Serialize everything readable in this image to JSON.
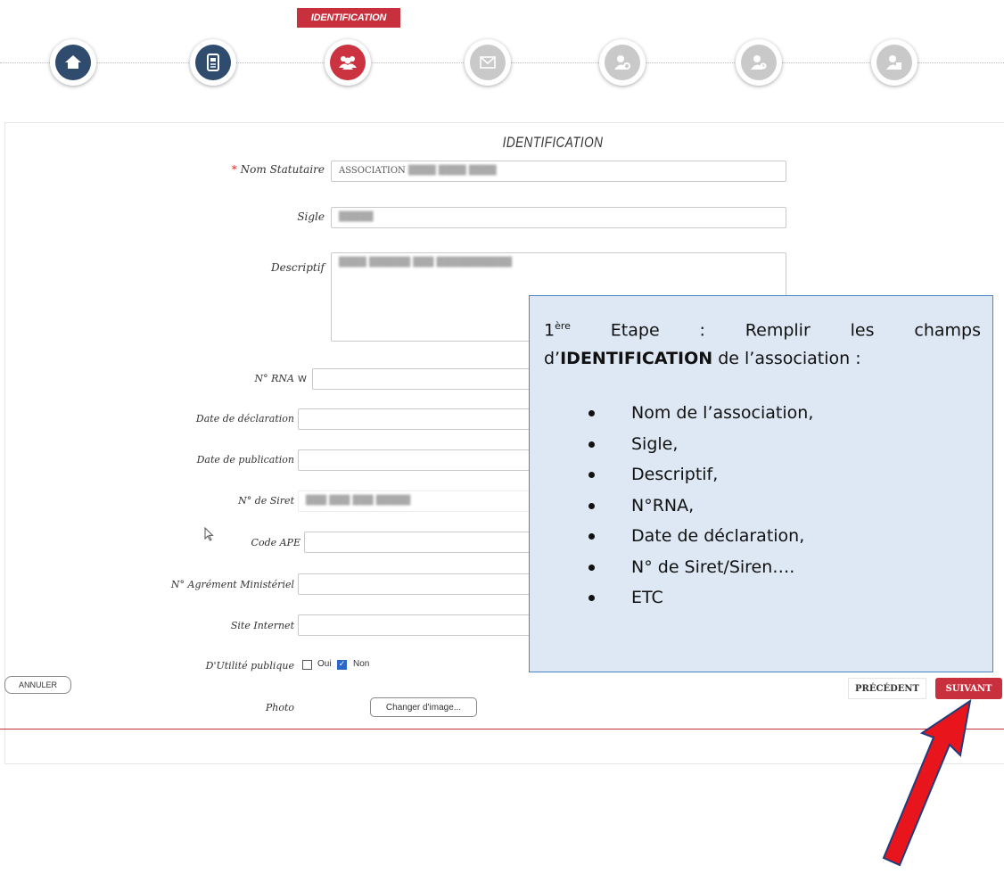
{
  "stepper": {
    "active_label": "IDENTIFICATION",
    "steps": [
      {
        "icon": "home-icon",
        "state": "done"
      },
      {
        "icon": "document-icon",
        "state": "done"
      },
      {
        "icon": "group-icon",
        "state": "active"
      },
      {
        "icon": "mail-icon",
        "state": "todo"
      },
      {
        "icon": "user-settings-icon",
        "state": "todo"
      },
      {
        "icon": "user-clock-icon",
        "state": "todo"
      },
      {
        "icon": "user-document-icon",
        "state": "todo"
      }
    ]
  },
  "form": {
    "title": "IDENTIFICATION",
    "required_mark": "*",
    "nom_statutaire": {
      "label": "Nom Statutaire",
      "value_prefix": "ASSOCIATION"
    },
    "sigle": {
      "label": "Sigle"
    },
    "descriptif": {
      "label": "Descriptif"
    },
    "rna": {
      "label": "N° RNA",
      "prefix": "W"
    },
    "date_declaration": {
      "label": "Date de déclaration"
    },
    "date_publication": {
      "label": "Date de publication"
    },
    "siret": {
      "label": "N° de Siret"
    },
    "code_ape": {
      "label": "Code APE"
    },
    "agrement": {
      "label": "N° Agrément Ministériel"
    },
    "site": {
      "label": "Site Internet"
    },
    "utilite": {
      "label": "D'Utilité publique",
      "oui": "Oui",
      "non": "Non",
      "oui_checked": false,
      "non_checked": true
    },
    "photo": {
      "label": "Photo",
      "button": "Changer d'image..."
    }
  },
  "callout": {
    "ordinal": "1",
    "ordinal_sup": "ère",
    "intro_a": "Etape : Remplir les champs d’",
    "intro_bold": "IDENTIFICATION",
    "intro_b": " de l’association :",
    "items": [
      "Nom de l’association,",
      "Sigle,",
      "Descriptif,",
      "N°RNA,",
      "Date de déclaration,",
      "N° de Siret/Siren….",
      "ETC"
    ]
  },
  "footer": {
    "cancel": "ANNULER",
    "previous": "PRÉCÉDENT",
    "next": "SUIVANT"
  },
  "colors": {
    "accent": "#c8303d",
    "step_done": "#2f4b6e",
    "step_todo": "#c9c9c9",
    "callout_bg": "#dde8f4",
    "callout_border": "#4a86c5"
  }
}
